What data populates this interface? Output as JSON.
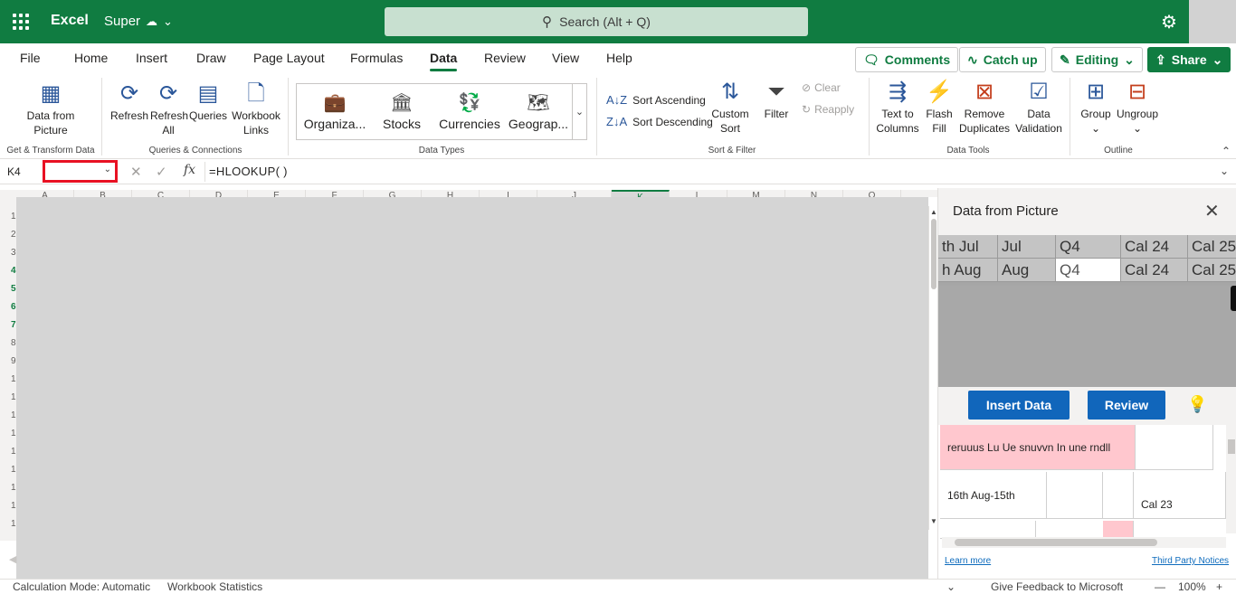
{
  "app": {
    "name": "Excel",
    "document": "Super",
    "search_placeholder": "Search (Alt + Q)"
  },
  "menu": {
    "tabs": [
      "File",
      "Home",
      "Insert",
      "Draw",
      "Page Layout",
      "Formulas",
      "Data",
      "Review",
      "View",
      "Help"
    ],
    "active_tab": "Data",
    "comments": "Comments",
    "catch_up": "Catch up",
    "editing": "Editing",
    "share": "Share"
  },
  "ribbon": {
    "get_transform": {
      "data_from_picture": [
        "Data from",
        "Picture"
      ],
      "label": "Get & Transform Data"
    },
    "queries": {
      "refresh": "Refresh",
      "refresh_all": [
        "Refresh",
        "All"
      ],
      "queries": "Queries",
      "workbook_links": [
        "Workbook",
        "Links"
      ],
      "label": "Queries & Connections"
    },
    "data_types": {
      "items": [
        "Organiza...",
        "Stocks",
        "Currencies",
        "Geograp..."
      ],
      "label": "Data Types"
    },
    "sort_filter": {
      "sort_ascending": "Sort Ascending",
      "sort_descending": "Sort Descending",
      "custom_sort": [
        "Custom",
        "Sort"
      ],
      "filter": "Filter",
      "clear": "Clear",
      "reapply": "Reapply",
      "label": "Sort & Filter"
    },
    "data_tools": {
      "text_to_columns": [
        "Text to",
        "Columns"
      ],
      "flash_fill": [
        "Flash",
        "Fill"
      ],
      "remove_duplicates": [
        "Remove",
        "Duplicates"
      ],
      "data_validation": [
        "Data",
        "Validation"
      ],
      "label": "Data Tools"
    },
    "outline": {
      "group": "Group",
      "ungroup": "Ungroup",
      "label": "Outline"
    }
  },
  "formula_bar": {
    "name_box": "K4",
    "fx": "fx",
    "formula": "=HLOOKUP( )"
  },
  "grid": {
    "columns": [
      "A",
      "B",
      "C",
      "D",
      "E",
      "F",
      "G",
      "H",
      "I",
      "J",
      "K",
      "L",
      "M",
      "N",
      "O"
    ],
    "active_column": "K",
    "rows": [
      "1",
      "2",
      "3",
      "4",
      "5",
      "6",
      "7",
      "8",
      "9",
      "1",
      "1",
      "1",
      "1",
      "1",
      "1",
      "1",
      "1",
      "1",
      "1"
    ],
    "active_rows": [
      3,
      4,
      5,
      6
    ]
  },
  "panel": {
    "title": "Data from Picture",
    "preview": {
      "row1": [
        "th Jul",
        "Jul",
        "Q4",
        "Cal 24",
        "Cal 25"
      ],
      "row2": [
        "h Aug",
        "Aug",
        "Q4",
        "Cal 24",
        "Cal 25"
      ]
    },
    "insert_data": "Insert Data",
    "review": "Review",
    "results": {
      "r1c1": "reruuus Lu Ue snuvvn In une rndll",
      "r2c1": "16th Aug-15th",
      "r2c4": "Cal 23"
    },
    "learn_more": "Learn more",
    "third_party": "Third Party Notices"
  },
  "status": {
    "calc_mode": "Calculation Mode: Automatic",
    "workbook_stats": "Workbook Statistics",
    "feedback": "Give Feedback to Microsoft",
    "zoom_minus": "—",
    "zoom": "100%",
    "zoom_plus": "+"
  },
  "colors": {
    "brand": "#107c41",
    "panel_button": "#1166bb",
    "error_fill": "#ffc7ce",
    "highlight_box": "#e81123"
  }
}
